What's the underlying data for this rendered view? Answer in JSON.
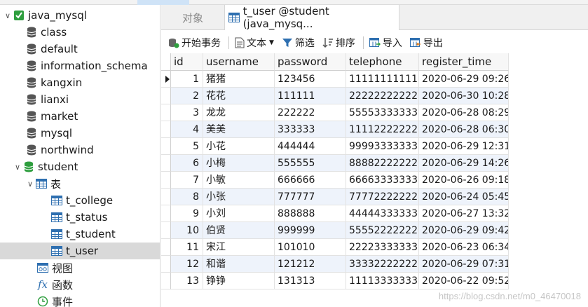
{
  "navigator": {
    "connection": "java_mysql",
    "databases": [
      {
        "name": "class"
      },
      {
        "name": "default"
      },
      {
        "name": "information_schema"
      },
      {
        "name": "kangxin"
      },
      {
        "name": "lianxi"
      },
      {
        "name": "market"
      },
      {
        "name": "mysql"
      },
      {
        "name": "northwind"
      }
    ],
    "active_database": "student",
    "tables_group": "表",
    "tables": [
      "t_college",
      "t_status",
      "t_student",
      "t_user"
    ],
    "selected_table": "t_user",
    "views_group": "视图",
    "functions_group": "函数",
    "events_group": "事件"
  },
  "tabs": {
    "objects": "对象",
    "active": "t_user @student (java_mysq..."
  },
  "toolbar": {
    "begin_transaction": "开始事务",
    "text": "文本",
    "filter": "筛选",
    "sort": "排序",
    "import": "导入",
    "export": "导出"
  },
  "grid": {
    "columns": [
      "id",
      "username",
      "password",
      "telephone",
      "register_time"
    ],
    "rows": [
      [
        "1",
        "猪猪",
        "123456",
        "11111111111",
        "2020-06-29 09:26"
      ],
      [
        "2",
        "花花",
        "111111",
        "22222222222",
        "2020-06-30 10:28"
      ],
      [
        "3",
        "龙龙",
        "222222",
        "55553333333",
        "2020-06-28 08:29"
      ],
      [
        "4",
        "美美",
        "333333",
        "11112222222",
        "2020-06-28 06:30"
      ],
      [
        "5",
        "小花",
        "444444",
        "99993333333",
        "2020-06-29 12:31"
      ],
      [
        "6",
        "小梅",
        "555555",
        "88882222222",
        "2020-06-29 14:26"
      ],
      [
        "7",
        "小敏",
        "666666",
        "66663333333",
        "2020-06-26 09:18"
      ],
      [
        "8",
        "小张",
        "777777",
        "77772222222",
        "2020-06-24 05:45"
      ],
      [
        "9",
        "小刘",
        "888888",
        "44444333333",
        "2020-06-27 13:32"
      ],
      [
        "10",
        "伯贤",
        "999999",
        "55552222222",
        "2020-06-29 09:42"
      ],
      [
        "11",
        "宋江",
        "101010",
        "22223333333",
        "2020-06-23 06:34"
      ],
      [
        "12",
        "和谐",
        "121212",
        "33332222222",
        "2020-06-29 07:31"
      ],
      [
        "13",
        "铮铮",
        "131313",
        "11113333333",
        "2020-06-22 09:52"
      ]
    ]
  },
  "watermark": "https://blog.csdn.net/m0_46470018",
  "colors": {
    "selection": "#d9d9d9",
    "alt_row": "#eef3fb",
    "db_icon": "#555555",
    "active_db_icon": "#2e9e3e",
    "table_icon": "#2e6fb0"
  }
}
